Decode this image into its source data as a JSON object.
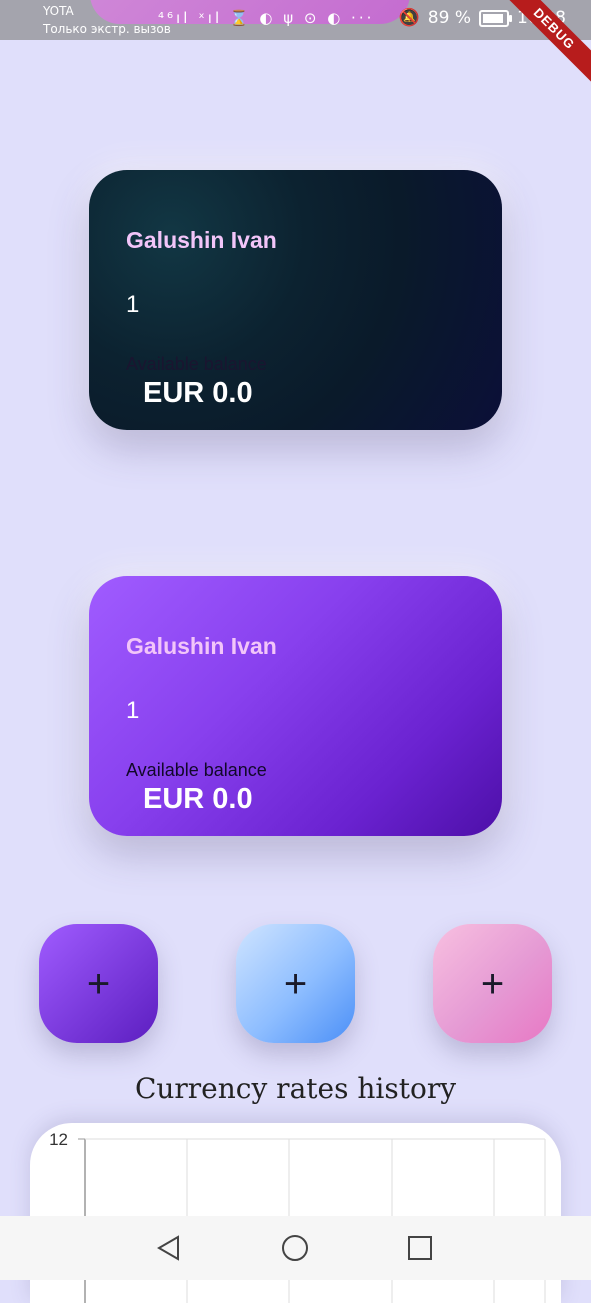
{
  "statusbar": {
    "carrier": "YOTA",
    "carrier_note": "Только экстр. вызов",
    "net_icons": "⁴⁶ıl ˣıl ⌛ ◐ ψ ⊙ ◐ ···",
    "battery": "89 %",
    "time": "16:28"
  },
  "debug_banner": "DEBUG",
  "cards": [
    {
      "name": "Galushin Ivan",
      "number": "1",
      "balance_label": "Available balance",
      "balance": "EUR 0.0"
    },
    {
      "name": "Galushin Ivan",
      "number": "1",
      "balance_label": "Available balance",
      "balance": "EUR 0.0"
    }
  ],
  "add_buttons": {
    "label": "+"
  },
  "rates_section": {
    "title": "Currency rates history"
  },
  "chart_data": {
    "type": "line",
    "yticks": [
      "12"
    ],
    "series": []
  },
  "colors": {
    "background": "#e0dffb",
    "card_dark": "#0b1a2a",
    "card_purple": "#8840ee",
    "name_text": "#f2c5f9"
  }
}
